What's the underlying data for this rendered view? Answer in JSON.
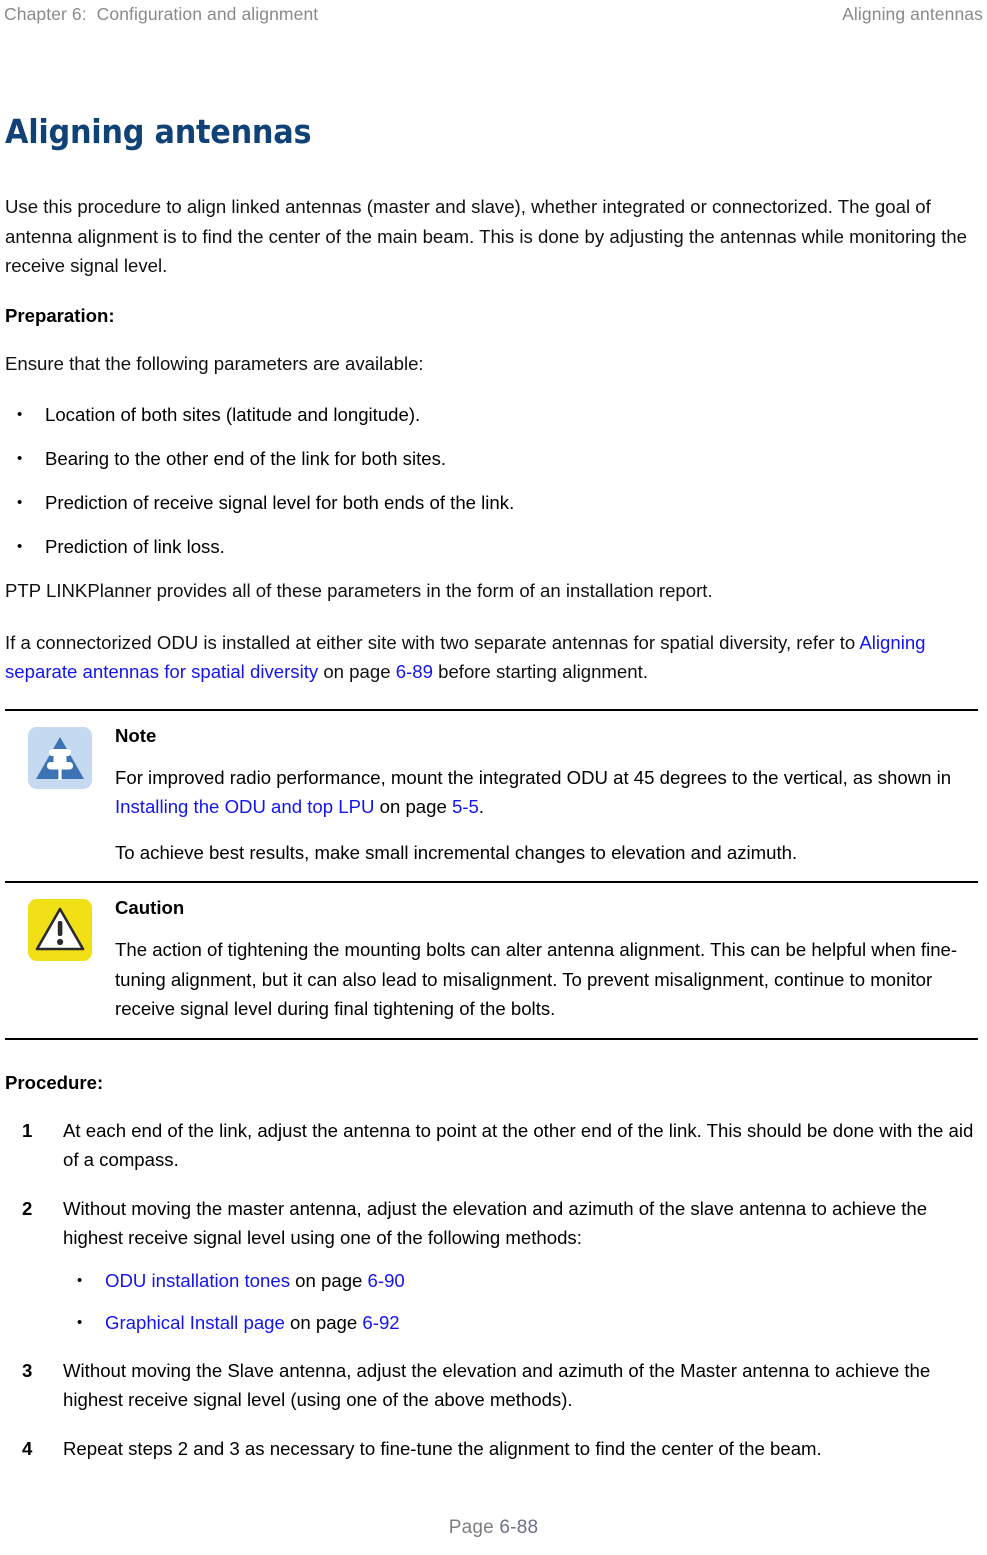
{
  "header": {
    "left": "Chapter 6:  Configuration and alignment",
    "right": "Aligning antennas"
  },
  "section": {
    "title": "Aligning antennas",
    "intro": "Use this procedure to align linked antennas (master and slave), whether integrated or connectorized. The goal of antenna alignment is to find the center of the main beam. This is done by adjusting the antennas while monitoring the receive signal level."
  },
  "preparation": {
    "heading": "Preparation:",
    "lead": "Ensure that the following parameters are available:",
    "bullets": [
      {
        "glyph": "•",
        "text": "Location of both sites (latitude and longitude)."
      },
      {
        "glyph": "•",
        "text": "Bearing to the other end of the link for both sites."
      },
      {
        "glyph": "•",
        "text": "Prediction of receive signal level for both ends of the link."
      },
      {
        "glyph": "•",
        "text": "Prediction of link loss."
      }
    ],
    "linkplanner": "PTP LINKPlanner provides all of these parameters in the form of an installation report.",
    "diversity": {
      "before_link": "If a connectorized ODU is installed at either site with two separate antennas for spatial diversity, refer to ",
      "link": "Aligning separate antennas for spatial diversity",
      "mid": " on page ",
      "pageref": "6-89",
      "after": " before starting alignment."
    }
  },
  "admonitions": [
    {
      "kind": "note",
      "icon": "note-pushpin-triangle-icon",
      "title": "Note",
      "para1": {
        "before_link": "For improved radio performance, mount the integrated ODU at 45 degrees to the vertical, as shown in ",
        "link": "Installing the ODU and top LPU",
        "mid": " on page ",
        "pageref": "5-5",
        "after": "."
      },
      "para2": "To achieve best results, make small incremental changes to elevation and azimuth."
    },
    {
      "kind": "caution",
      "icon": "caution-warning-triangle-icon",
      "title": "Caution",
      "para1": {
        "before_link": "The action of tightening the mounting bolts can alter antenna alignment. This can be helpful when fine-tuning alignment, but it can also lead to misalignment. To prevent misalignment, continue to monitor receive signal level during final tightening of the bolts.",
        "link": "",
        "mid": "",
        "pageref": "",
        "after": ""
      },
      "para2": ""
    }
  ],
  "procedure": {
    "heading": "Procedure:",
    "steps": [
      {
        "num": "1",
        "text": "At each end of the link, adjust the antenna to point at the other end of the link. This should be done with the aid of a compass."
      },
      {
        "num": "2",
        "text": "Without moving the master antenna, adjust the elevation and azimuth of the slave antenna to achieve the highest receive signal level using one of the following methods:",
        "sub_bullets": [
          {
            "glyph": "•",
            "link": "ODU installation tones",
            "mid": " on page ",
            "pageref": "6-90"
          },
          {
            "glyph": "•",
            "link": "Graphical Install page",
            "mid": " on page ",
            "pageref": "6-92"
          }
        ]
      },
      {
        "num": "3",
        "text": "Without moving the Slave antenna, adjust the elevation and azimuth of the Master antenna to achieve the highest receive signal level (using one of the above methods)."
      },
      {
        "num": "4",
        "text": "Repeat steps 2 and 3 as necessary to fine-tune the alignment to find the center of the beam."
      }
    ]
  },
  "footer": {
    "label": "Page ",
    "folio": "6-88"
  },
  "colors": {
    "title_blue": "#114277",
    "link_blue": "#1414ee",
    "note_bg": "#c5d9f1",
    "note_triangle": "#3d72b4",
    "caution_bg": "#f2e017",
    "header_gray": "#8a8a8a",
    "footer_gray": "#7e7e7e"
  }
}
